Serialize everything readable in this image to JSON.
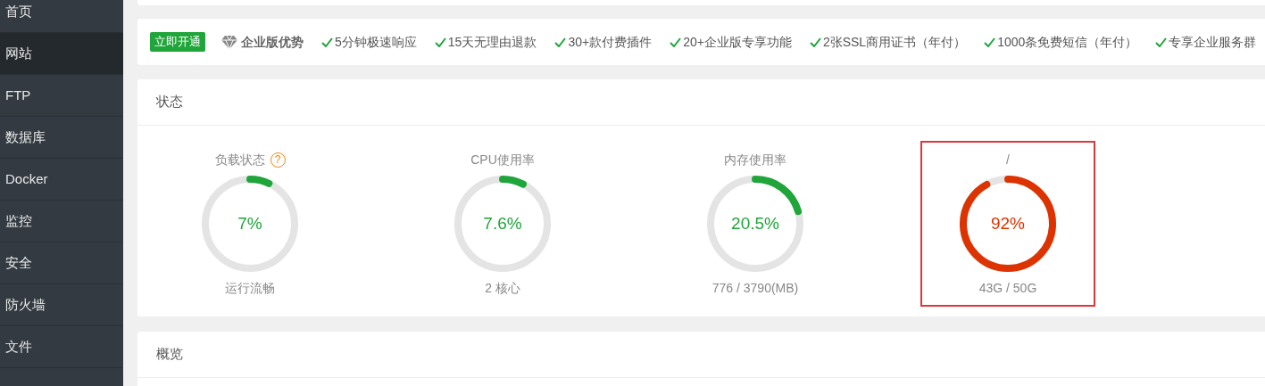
{
  "sidebar": {
    "items": [
      {
        "label": "首页",
        "selected": false
      },
      {
        "label": "网站",
        "selected": true
      },
      {
        "label": "FTP",
        "selected": false
      },
      {
        "label": "数据库",
        "selected": false
      },
      {
        "label": "Docker",
        "selected": false
      },
      {
        "label": "监控",
        "selected": false
      },
      {
        "label": "安全",
        "selected": false
      },
      {
        "label": "防火墙",
        "selected": false
      },
      {
        "label": "文件",
        "selected": false
      }
    ]
  },
  "banner": {
    "button": "立即开通",
    "title": "企业版优势",
    "features": [
      "5分钟极速响应",
      "15天无理由退款",
      "30+款付费插件",
      "20+企业版专享功能",
      "2张SSL商用证书（年付）",
      "1000条免费短信（年付）",
      "专享企业服务群"
    ]
  },
  "status": {
    "title": "状态",
    "gauges": [
      {
        "title": "负载状态",
        "help": "?",
        "value": "7%",
        "detail": "运行流畅",
        "level": 0.07,
        "color": "#20a53a",
        "highlighted": false
      },
      {
        "title": "CPU使用率",
        "value": "7.6%",
        "detail": "2 核心",
        "level": 0.076,
        "color": "#20a53a",
        "highlighted": false
      },
      {
        "title": "内存使用率",
        "value": "20.5%",
        "detail": "776 / 3790(MB)",
        "level": 0.205,
        "color": "#20a53a",
        "highlighted": false
      },
      {
        "title": "/",
        "value": "92%",
        "detail": "43G / 50G",
        "level": 0.92,
        "color": "#dd3300",
        "highlighted": true
      }
    ]
  },
  "overview": {
    "title": "概览"
  }
}
